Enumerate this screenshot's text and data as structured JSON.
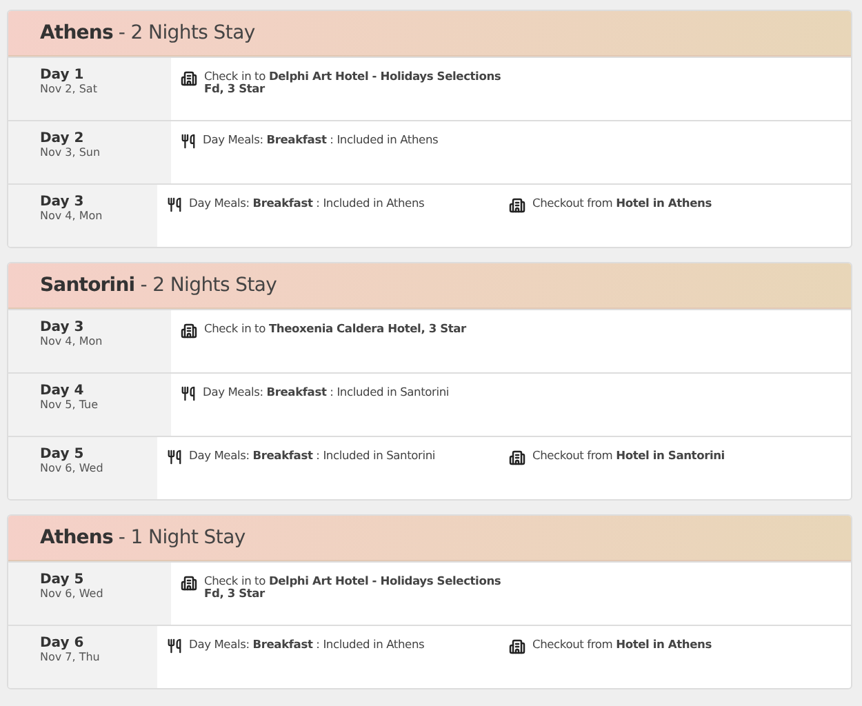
{
  "sections": [
    {
      "city": "Athens",
      "stay": "- 2 Nights Stay",
      "days": [
        {
          "day": "Day 1",
          "date": "Nov 2, Sat",
          "items": [
            {
              "kind": "hotel",
              "text": "Check in to **Delphi Art Hotel - Holidays Selections Fd, 3 Star**"
            }
          ]
        },
        {
          "day": "Day 2",
          "date": "Nov 3, Sun",
          "items": [
            {
              "kind": "meal",
              "text": "Day Meals: **Breakfast** : Included in Athens"
            }
          ]
        },
        {
          "day": "Day 3",
          "date": "Nov 4, Mon",
          "items": [
            {
              "kind": "meal",
              "text": "Day Meals: **Breakfast** : Included in Athens"
            },
            {
              "kind": "hotel",
              "text": "Checkout from **Hotel in Athens**"
            }
          ]
        }
      ]
    },
    {
      "city": "Santorini",
      "stay": "- 2 Nights Stay",
      "days": [
        {
          "day": "Day 3",
          "date": "Nov 4, Mon",
          "items": [
            {
              "kind": "hotel",
              "text": "Check in to **Theoxenia Caldera Hotel, 3 Star**"
            }
          ]
        },
        {
          "day": "Day 4",
          "date": "Nov 5, Tue",
          "items": [
            {
              "kind": "meal",
              "text": "Day Meals: **Breakfast** : Included in Santorini"
            }
          ]
        },
        {
          "day": "Day 5",
          "date": "Nov 6, Wed",
          "items": [
            {
              "kind": "meal",
              "text": "Day Meals: **Breakfast** : Included in Santorini"
            },
            {
              "kind": "hotel",
              "text": "Checkout from **Hotel in Santorini**"
            }
          ]
        }
      ]
    },
    {
      "city": "Athens",
      "stay": "- 1 Night Stay",
      "days": [
        {
          "day": "Day 5",
          "date": "Nov 6, Wed",
          "items": [
            {
              "kind": "hotel",
              "text": "Check in to **Delphi Art Hotel - Holidays Selections Fd, 3 Star**"
            }
          ]
        },
        {
          "day": "Day 6",
          "date": "Nov 7, Thu",
          "items": [
            {
              "kind": "meal",
              "text": "Day Meals: **Breakfast** : Included in Athens"
            },
            {
              "kind": "hotel",
              "text": "Checkout from **Hotel in Athens**"
            }
          ]
        }
      ]
    }
  ]
}
